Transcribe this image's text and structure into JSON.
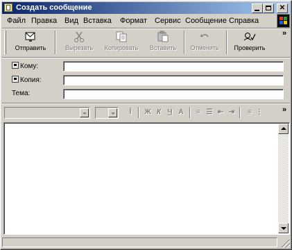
{
  "window": {
    "title": "Создать сообщение"
  },
  "menu": [
    "Файл",
    "Правка",
    "Вид",
    "Вставка",
    "Формат",
    "Сервис",
    "Сообщение",
    "Справка"
  ],
  "toolbar": {
    "send": "Отправить",
    "cut": "Вырезать",
    "copy": "Копировать",
    "paste": "Вставить",
    "undo": "Отменить",
    "check": "Проверить",
    "more": "»"
  },
  "headers": {
    "to": "Кому:",
    "cc": "Копия:",
    "subject": "Тема:",
    "to_value": "",
    "cc_value": "",
    "subject_value": ""
  },
  "format": {
    "font_name": "",
    "font_size": "",
    "bold": "Ж",
    "italic": "К",
    "underline": "Ч",
    "more": "»"
  },
  "message": {
    "body": ""
  }
}
